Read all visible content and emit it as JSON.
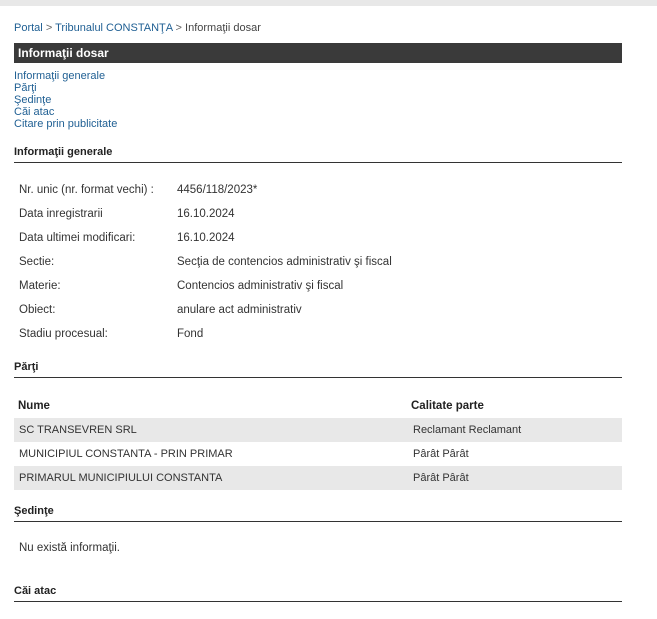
{
  "breadcrumb": {
    "portal": "Portal",
    "sep1": ">",
    "court": "Tribunalul CONSTANŢA",
    "sep2": ">",
    "current": "Informaţii dosar"
  },
  "title": "Informaţii dosar",
  "nav": {
    "items": [
      {
        "label": "Informaţii generale"
      },
      {
        "label": "Părţi"
      },
      {
        "label": "Şedinţe"
      },
      {
        "label": "Căi atac"
      },
      {
        "label": "Citare prin publicitate"
      }
    ]
  },
  "general": {
    "heading": "Informaţii generale",
    "rows": [
      {
        "label": "Nr. unic (nr. format vechi) :",
        "value": "4456/118/2023*"
      },
      {
        "label": "Data inregistrarii",
        "value": "16.10.2024"
      },
      {
        "label": "Data ultimei modificari:",
        "value": "16.10.2024"
      },
      {
        "label": "Sectie:",
        "value": "Secţia de contencios administrativ şi fiscal"
      },
      {
        "label": "Materie:",
        "value": "Contencios administrativ şi fiscal"
      },
      {
        "label": "Obiect:",
        "value": "anulare act administrativ"
      },
      {
        "label": "Stadiu procesual:",
        "value": "Fond"
      }
    ]
  },
  "parti": {
    "heading": "Părţi",
    "columns": {
      "name": "Nume",
      "calitate": "Calitate parte"
    },
    "rows": [
      {
        "name": "SC TRANSEVREN SRL",
        "calitate": "Reclamant Reclamant"
      },
      {
        "name": "MUNICIPIUL CONSTANTA - PRIN PRIMAR",
        "calitate": "Pârât Pârât"
      },
      {
        "name": "PRIMARUL MUNICIPIULUI CONSTANTA",
        "calitate": "Pârât Pârât"
      }
    ]
  },
  "sedinte": {
    "heading": "Şedinţe",
    "empty_text": "Nu există informaţii."
  },
  "cai_atac": {
    "heading": "Căi atac"
  }
}
